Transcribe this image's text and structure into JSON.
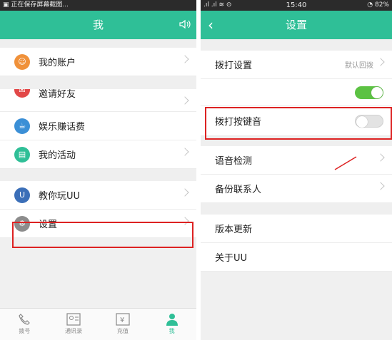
{
  "left": {
    "status_text": "正在保存屏幕截图...",
    "header_title": "我",
    "menu": {
      "account": "我的账户",
      "invite": "邀请好友",
      "entertainment": "娱乐赚话费",
      "activities": "我的活动",
      "tutorial": "教你玩UU",
      "settings": "设置"
    },
    "tabs": {
      "dial": "拨号",
      "contacts": "通讯录",
      "recharge": "充值",
      "me": "我"
    }
  },
  "right": {
    "status_time": "15:40",
    "status_battery": "82%",
    "header_title": "设置",
    "rows": {
      "dial_settings": "拨打设置",
      "dial_settings_value": "默认回拨",
      "key_tone": "拨打按键音",
      "voice_check": "语音检测",
      "backup_contacts": "备份联系人",
      "version_update": "版本更新",
      "about": "关于UU"
    },
    "toggles": {
      "top_toggle": true,
      "key_tone": false
    }
  },
  "colors": {
    "accent": "#2fbf97",
    "highlight": "#dd2222",
    "toggle_on": "#5cc243"
  }
}
